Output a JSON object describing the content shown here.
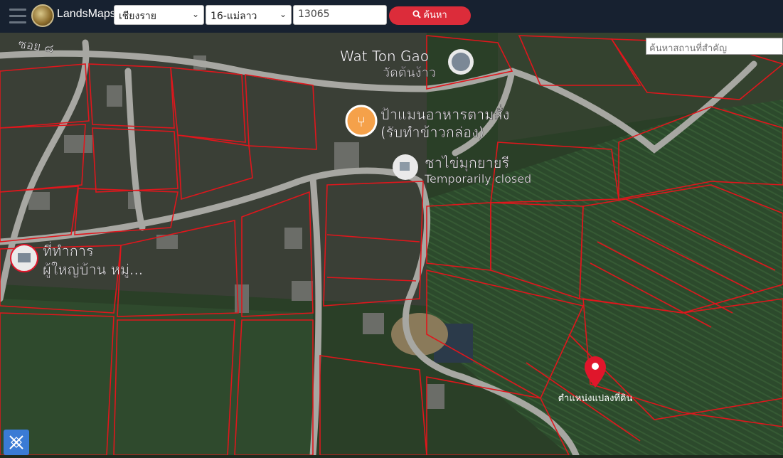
{
  "header": {
    "brand": "LandsMaps",
    "province": "เชียงราย",
    "district": "16-แม่ลาว",
    "parcel_no": "13065",
    "search_label": "ค้นหา"
  },
  "map": {
    "place_search_placeholder": "ค้นหาสถานที่สำคัญ",
    "labels": {
      "temple_en": "Wat Ton Gao",
      "temple_th": "วัดต้นง้าว",
      "restaurant_line1": "ป้าแมนอาหารตามสั่ง",
      "restaurant_line2": "(รับทำข้าวกล่อง)",
      "cafe_name": "ชาไข่มุกยายรี",
      "cafe_status": "Temporarily closed",
      "office_line1": "ที่ทำการ",
      "office_line2": "ผู้ใหญ่บ้าน หมู่...",
      "road": "ซอย ๘",
      "parcel_marker": "ตำแหน่งแปลงที่ดิน"
    }
  },
  "colors": {
    "header_bg": "#172130",
    "search_button": "#dc2c3a",
    "parcel_lines": "#e0161c",
    "marker": "#e0162b"
  }
}
